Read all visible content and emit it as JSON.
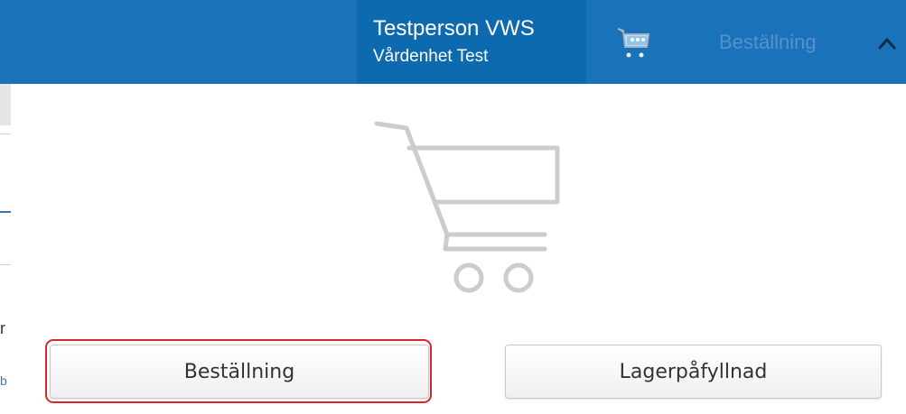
{
  "header": {
    "user_name": "Testperson VWS",
    "unit_name": "Vårdenhet Test",
    "cart_icon": "shopping-cart-icon",
    "order_label": "Beställning",
    "chevron_icon": "chevron-up-icon"
  },
  "main": {
    "empty_cart_icon": "shopping-cart-icon",
    "buttons": {
      "order": "Beställning",
      "restock": "Lagerpåfyllnad"
    }
  },
  "left_strip": {
    "chars": [
      "r",
      "b"
    ]
  },
  "colors": {
    "header_bg": "#1a73b8",
    "user_block_bg": "#0e6aae",
    "order_label": "#5a8fcf",
    "highlight": "#d8262a",
    "cart_gray": "#cccccc"
  }
}
